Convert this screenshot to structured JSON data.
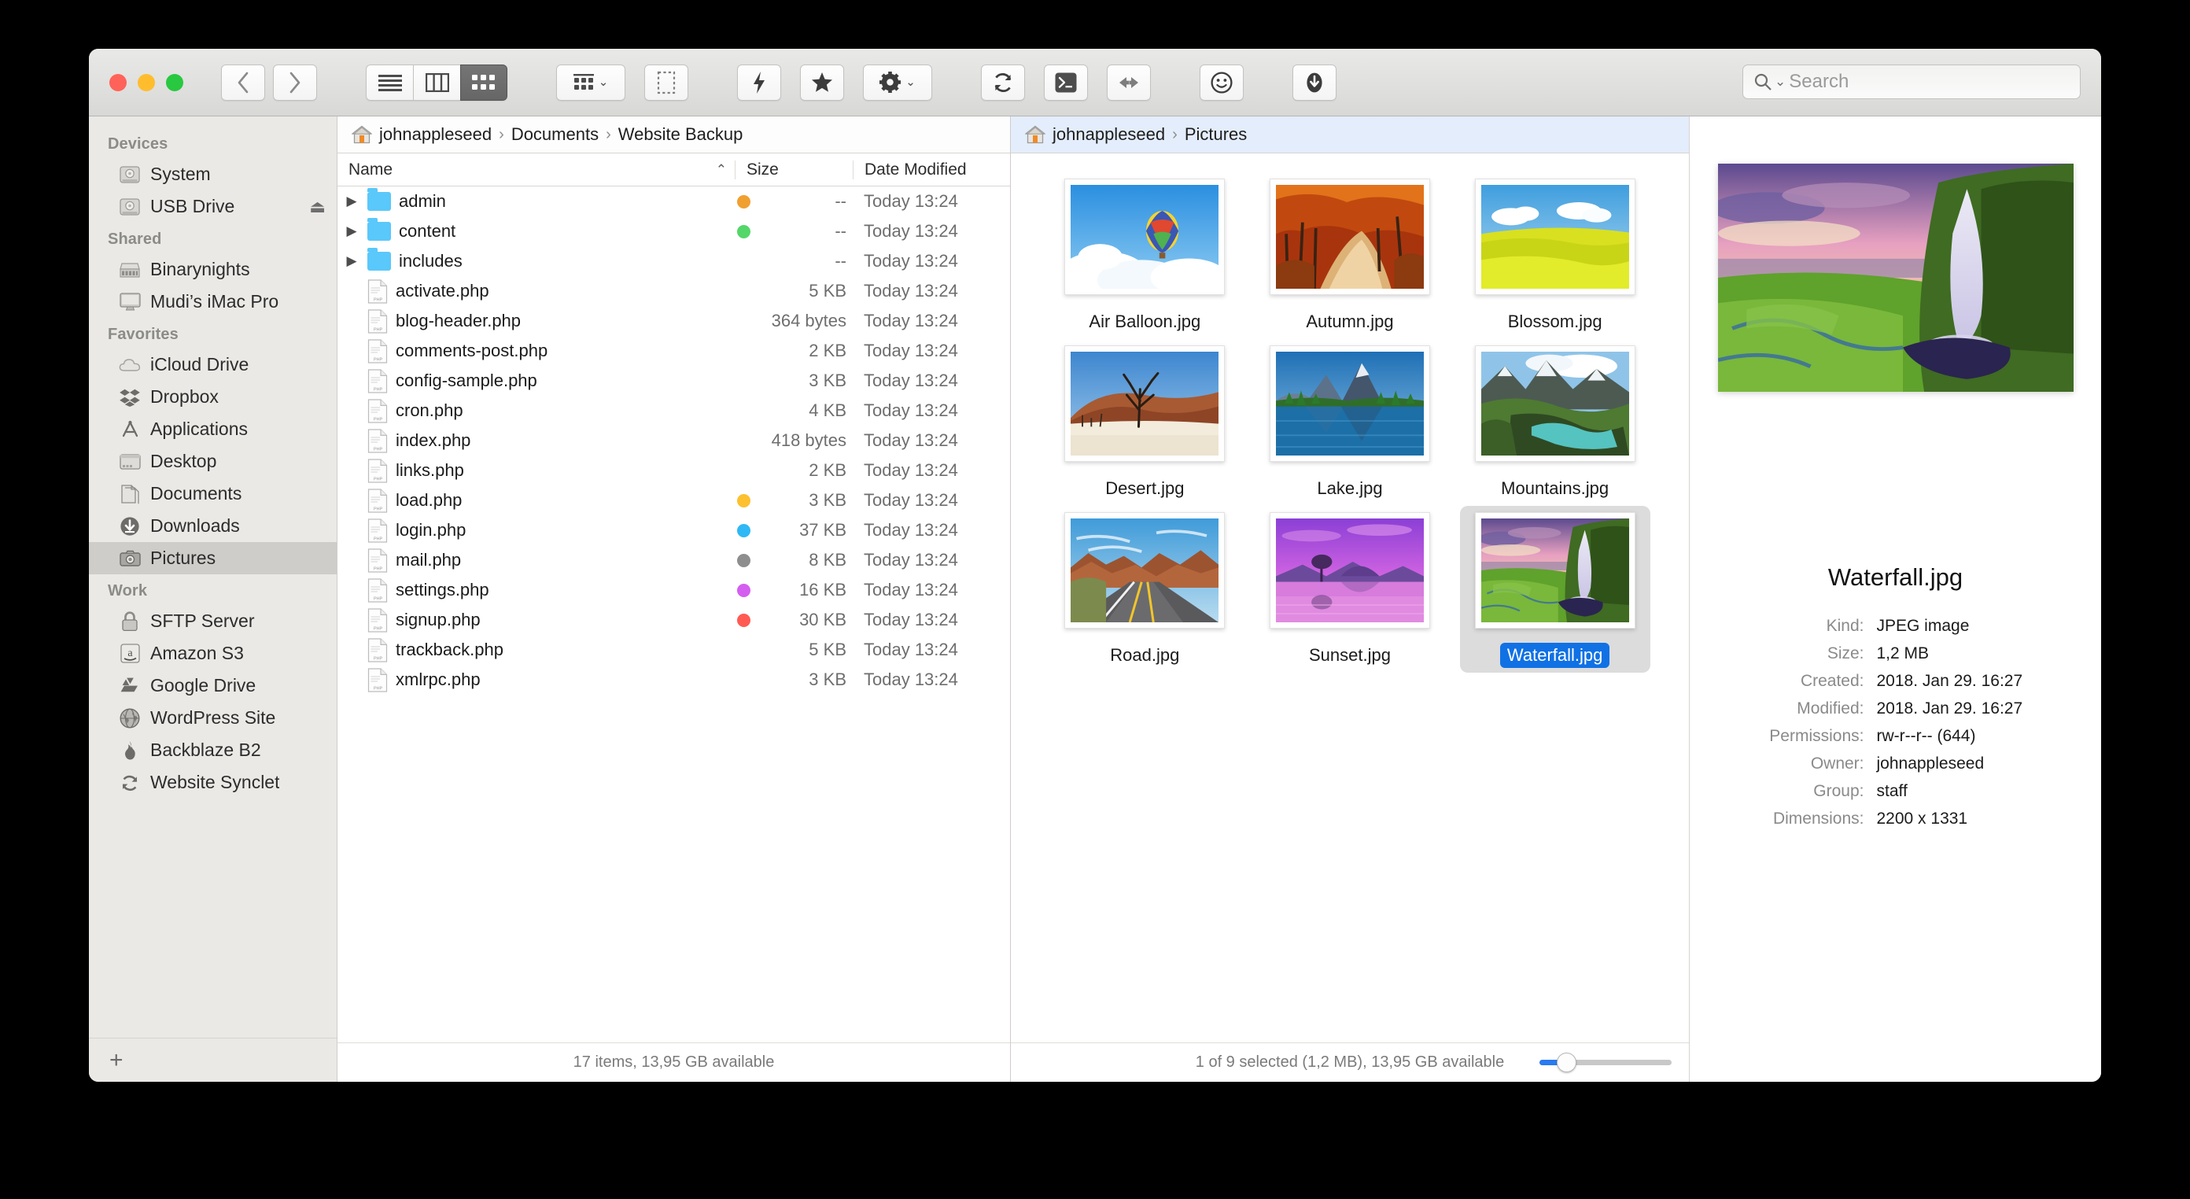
{
  "window": {
    "traffic_lights": [
      "close",
      "minimize",
      "maximize"
    ]
  },
  "toolbar": {
    "back_label": "‹",
    "forward_label": "›",
    "view_list": "list-view",
    "view_column": "column-view",
    "view_icon": "icon-view",
    "arrange_label": "arrange",
    "arrange_caret": "⌄",
    "select_label": "select",
    "action_label": "quick-action",
    "favorites_label": "favorites",
    "gear_label": "settings",
    "gear_caret": "⌄",
    "sync_label": "sync",
    "terminal_label": "terminal",
    "merge_label": "merge",
    "smiley_label": "smiley",
    "download_label": "download"
  },
  "search": {
    "icon": "Q",
    "caret": "⌄",
    "placeholder": "Search",
    "value": ""
  },
  "sidebar": {
    "add_button": "+",
    "sections": [
      {
        "header": "Devices",
        "items": [
          {
            "label": "System",
            "icon": "hard-drive-icon",
            "eject": false,
            "selected": false
          },
          {
            "label": "USB Drive",
            "icon": "hard-drive-icon",
            "eject": true,
            "eject_glyph": "⏏",
            "selected": false
          }
        ]
      },
      {
        "header": "Shared",
        "items": [
          {
            "label": "Binarynights",
            "icon": "server-icon",
            "eject": false,
            "selected": false
          },
          {
            "label": "Mudi’s iMac Pro",
            "icon": "imac-icon",
            "eject": false,
            "selected": false
          }
        ]
      },
      {
        "header": "Favorites",
        "items": [
          {
            "label": "iCloud Drive",
            "icon": "cloud-icon",
            "eject": false,
            "selected": false
          },
          {
            "label": "Dropbox",
            "icon": "dropbox-icon",
            "eject": false,
            "selected": false
          },
          {
            "label": "Applications",
            "icon": "applications-icon",
            "eject": false,
            "selected": false
          },
          {
            "label": "Desktop",
            "icon": "desktop-icon",
            "eject": false,
            "selected": false
          },
          {
            "label": "Documents",
            "icon": "documents-icon",
            "eject": false,
            "selected": false
          },
          {
            "label": "Downloads",
            "icon": "downloads-icon",
            "eject": false,
            "selected": false
          },
          {
            "label": "Pictures",
            "icon": "camera-icon",
            "eject": false,
            "selected": true
          }
        ]
      },
      {
        "header": "Work",
        "items": [
          {
            "label": "SFTP Server",
            "icon": "lock-icon",
            "eject": false,
            "selected": false
          },
          {
            "label": "Amazon S3",
            "icon": "amazon-icon",
            "eject": false,
            "selected": false
          },
          {
            "label": "Google Drive",
            "icon": "google-drive-icon",
            "eject": false,
            "selected": false
          },
          {
            "label": "WordPress Site",
            "icon": "globe-icon",
            "eject": false,
            "selected": false
          },
          {
            "label": "Backblaze B2",
            "icon": "flame-icon",
            "eject": false,
            "selected": false
          },
          {
            "label": "Website Synclet",
            "icon": "sync-icon",
            "eject": false,
            "selected": false
          }
        ]
      }
    ]
  },
  "left_pane": {
    "breadcrumb": {
      "home_icon": "home-icon",
      "parts": [
        "johnappleseed",
        "Documents",
        "Website Backup"
      ],
      "separator": "›"
    },
    "columns": {
      "name": "Name",
      "size": "Size",
      "date": "Date Modified",
      "sort_arrow": "⌃"
    },
    "rows": [
      {
        "name": "admin",
        "kind": "folder",
        "tag": "#f0a030",
        "size": "--",
        "date": "Today 13:24"
      },
      {
        "name": "content",
        "kind": "folder",
        "tag": "#53d769",
        "size": "--",
        "date": "Today 13:24"
      },
      {
        "name": "includes",
        "kind": "folder",
        "tag": "",
        "size": "--",
        "date": "Today 13:24"
      },
      {
        "name": "activate.php",
        "kind": "php",
        "tag": "",
        "size": "5 KB",
        "date": "Today 13:24"
      },
      {
        "name": "blog-header.php",
        "kind": "php",
        "tag": "",
        "size": "364 bytes",
        "date": "Today 13:24"
      },
      {
        "name": "comments-post.php",
        "kind": "php",
        "tag": "",
        "size": "2 KB",
        "date": "Today 13:24"
      },
      {
        "name": "config-sample.php",
        "kind": "php",
        "tag": "",
        "size": "3 KB",
        "date": "Today 13:24"
      },
      {
        "name": "cron.php",
        "kind": "php",
        "tag": "",
        "size": "4 KB",
        "date": "Today 13:24"
      },
      {
        "name": "index.php",
        "kind": "php",
        "tag": "",
        "size": "418 bytes",
        "date": "Today 13:24"
      },
      {
        "name": "links.php",
        "kind": "php",
        "tag": "",
        "size": "2 KB",
        "date": "Today 13:24"
      },
      {
        "name": "load.php",
        "kind": "php",
        "tag": "#fdc02f",
        "size": "3 KB",
        "date": "Today 13:24"
      },
      {
        "name": "login.php",
        "kind": "php",
        "tag": "#2fb8f5",
        "size": "37 KB",
        "date": "Today 13:24"
      },
      {
        "name": "mail.php",
        "kind": "php",
        "tag": "#8e8e8e",
        "size": "8 KB",
        "date": "Today 13:24"
      },
      {
        "name": "settings.php",
        "kind": "php",
        "tag": "#d45ef0",
        "size": "16 KB",
        "date": "Today 13:24"
      },
      {
        "name": "signup.php",
        "kind": "php",
        "tag": "#ff5b52",
        "size": "30 KB",
        "date": "Today 13:24"
      },
      {
        "name": "trackback.php",
        "kind": "php",
        "tag": "",
        "size": "5 KB",
        "date": "Today 13:24"
      },
      {
        "name": "xmlrpc.php",
        "kind": "php",
        "tag": "",
        "size": "3 KB",
        "date": "Today 13:24"
      }
    ],
    "status": "17 items, 13,95 GB available"
  },
  "right_pane": {
    "breadcrumb": {
      "home_icon": "home-icon",
      "parts": [
        "johnappleseed",
        "Pictures"
      ],
      "separator": "›"
    },
    "items": [
      {
        "name": "Air Balloon.jpg",
        "thumb": "air-balloon",
        "selected": false
      },
      {
        "name": "Autumn.jpg",
        "thumb": "autumn",
        "selected": false
      },
      {
        "name": "Blossom.jpg",
        "thumb": "blossom",
        "selected": false
      },
      {
        "name": "Desert.jpg",
        "thumb": "desert",
        "selected": false
      },
      {
        "name": "Lake.jpg",
        "thumb": "lake",
        "selected": false
      },
      {
        "name": "Mountains.jpg",
        "thumb": "mountains",
        "selected": false
      },
      {
        "name": "Road.jpg",
        "thumb": "road",
        "selected": false
      },
      {
        "name": "Sunset.jpg",
        "thumb": "sunset",
        "selected": false
      },
      {
        "name": "Waterfall.jpg",
        "thumb": "waterfall",
        "selected": true
      }
    ],
    "status": "1 of 9 selected (1,2 MB), 13,95 GB available",
    "zoom_percent": 16
  },
  "info_panel": {
    "preview_thumb": "waterfall",
    "title": "Waterfall.jpg",
    "fields": [
      {
        "key": "Kind:",
        "value": "JPEG image"
      },
      {
        "key": "Size:",
        "value": "1,2 MB"
      },
      {
        "key": "Created:",
        "value": "2018. Jan 29. 16:27"
      },
      {
        "key": "Modified:",
        "value": "2018. Jan 29. 16:27"
      },
      {
        "key": "Permissions:",
        "value": "rw-r--r-- (644)"
      },
      {
        "key": "Owner:",
        "value": "johnappleseed"
      },
      {
        "key": "Group:",
        "value": "staff"
      },
      {
        "key": "Dimensions:",
        "value": "2200 x 1331"
      }
    ]
  },
  "colors": {
    "selection_blue": "#1071e5",
    "sidebar_bg": "#ebe9e6",
    "focused_crumb": "#e4edfb"
  }
}
